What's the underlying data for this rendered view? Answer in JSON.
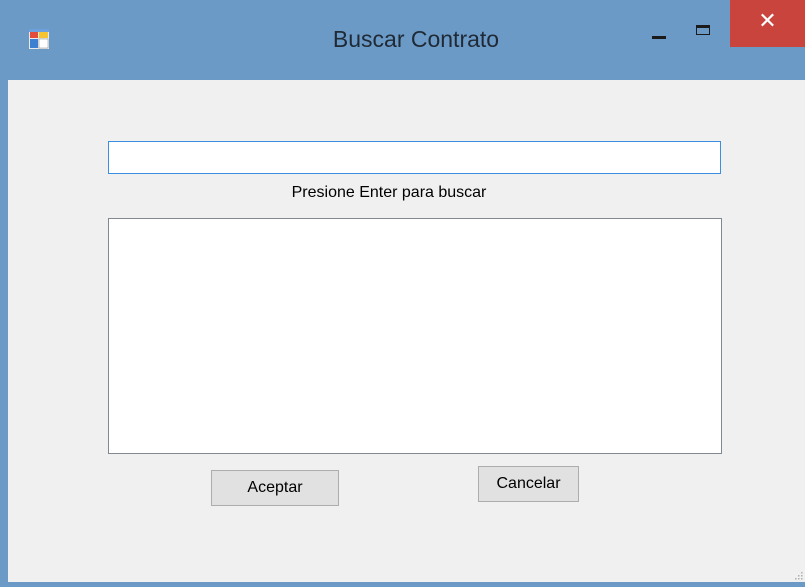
{
  "window": {
    "title": "Buscar Contrato",
    "close_symbol": "✕",
    "colors": {
      "titlebar": "#6b9ac6",
      "close": "#c9443d",
      "client": "#f0f0f0"
    }
  },
  "search": {
    "value": "",
    "hint": "Presione Enter para buscar"
  },
  "results": {
    "items": []
  },
  "buttons": {
    "accept_label": "Aceptar",
    "cancel_label": "Cancelar"
  },
  "icons": {
    "app": "app-icon",
    "minimize": "minimize-icon",
    "maximize": "maximize-icon",
    "close": "close-icon",
    "grip": "resize-grip-icon"
  }
}
